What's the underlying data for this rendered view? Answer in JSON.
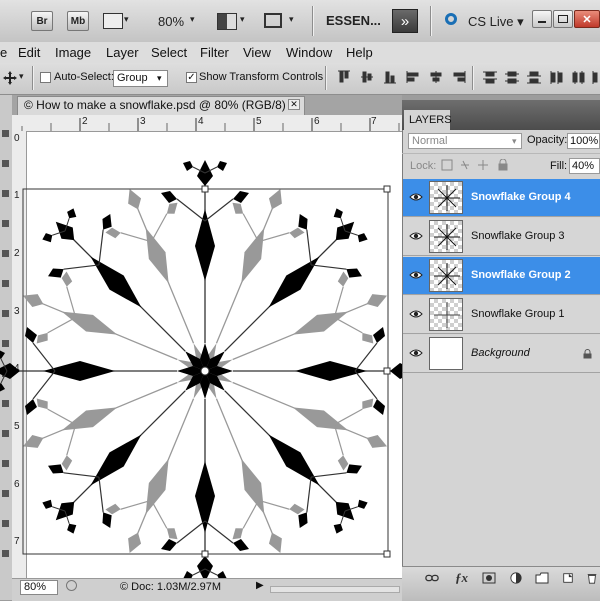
{
  "appbar": {
    "bridge_label": "Br",
    "minibridge_label": "Mb",
    "zoom_value": "80%",
    "workspace_label": "ESSEN...",
    "more_label": "»",
    "cslive_label": "CS Live ▾",
    "dropdown_arrow": "▾",
    "close_glyph": "✕"
  },
  "menubar": {
    "items": [
      "e",
      "Edit",
      "Image",
      "Layer",
      "Select",
      "Filter",
      "View",
      "Window",
      "Help"
    ]
  },
  "options": {
    "autoselect_label": "Auto-Select:",
    "autoselect_checked": false,
    "autoselect_target": "Group",
    "show_transform_label": "Show Transform Controls",
    "show_transform_checked": true,
    "check_glyph": "✓"
  },
  "document": {
    "tab_title": "© How to make a snowflake.psd @ 80% (RGB/8) *",
    "close_glyph": "✕",
    "ruler_h": [
      "2",
      "3",
      "4",
      "5",
      "6",
      "7"
    ],
    "ruler_v": [
      "0",
      "1",
      "2",
      "3",
      "4",
      "5",
      "6",
      "7"
    ]
  },
  "status": {
    "zoom": "80%",
    "doc_info": "© Doc: 1.03M/2.97M",
    "arrow": "▶"
  },
  "layers_panel": {
    "tab_label": "LAYERS",
    "blend_mode": "Normal",
    "opacity_label": "Opacity:",
    "opacity_value": "100%",
    "lock_label": "Lock:",
    "fill_label": "Fill:",
    "fill_value": "40%",
    "layers": [
      {
        "name": "Snowflake Group 4",
        "selected": true
      },
      {
        "name": "Snowflake Group 3",
        "selected": false
      },
      {
        "name": "Snowflake Group 2",
        "selected": true
      },
      {
        "name": "Snowflake Group 1",
        "selected": false
      },
      {
        "name": "Background",
        "selected": false,
        "locked": true
      }
    ]
  },
  "colors": {
    "selection_blue": "#3c8ee8",
    "snowflake_black": "#000000",
    "snowflake_gray": "#999999"
  }
}
